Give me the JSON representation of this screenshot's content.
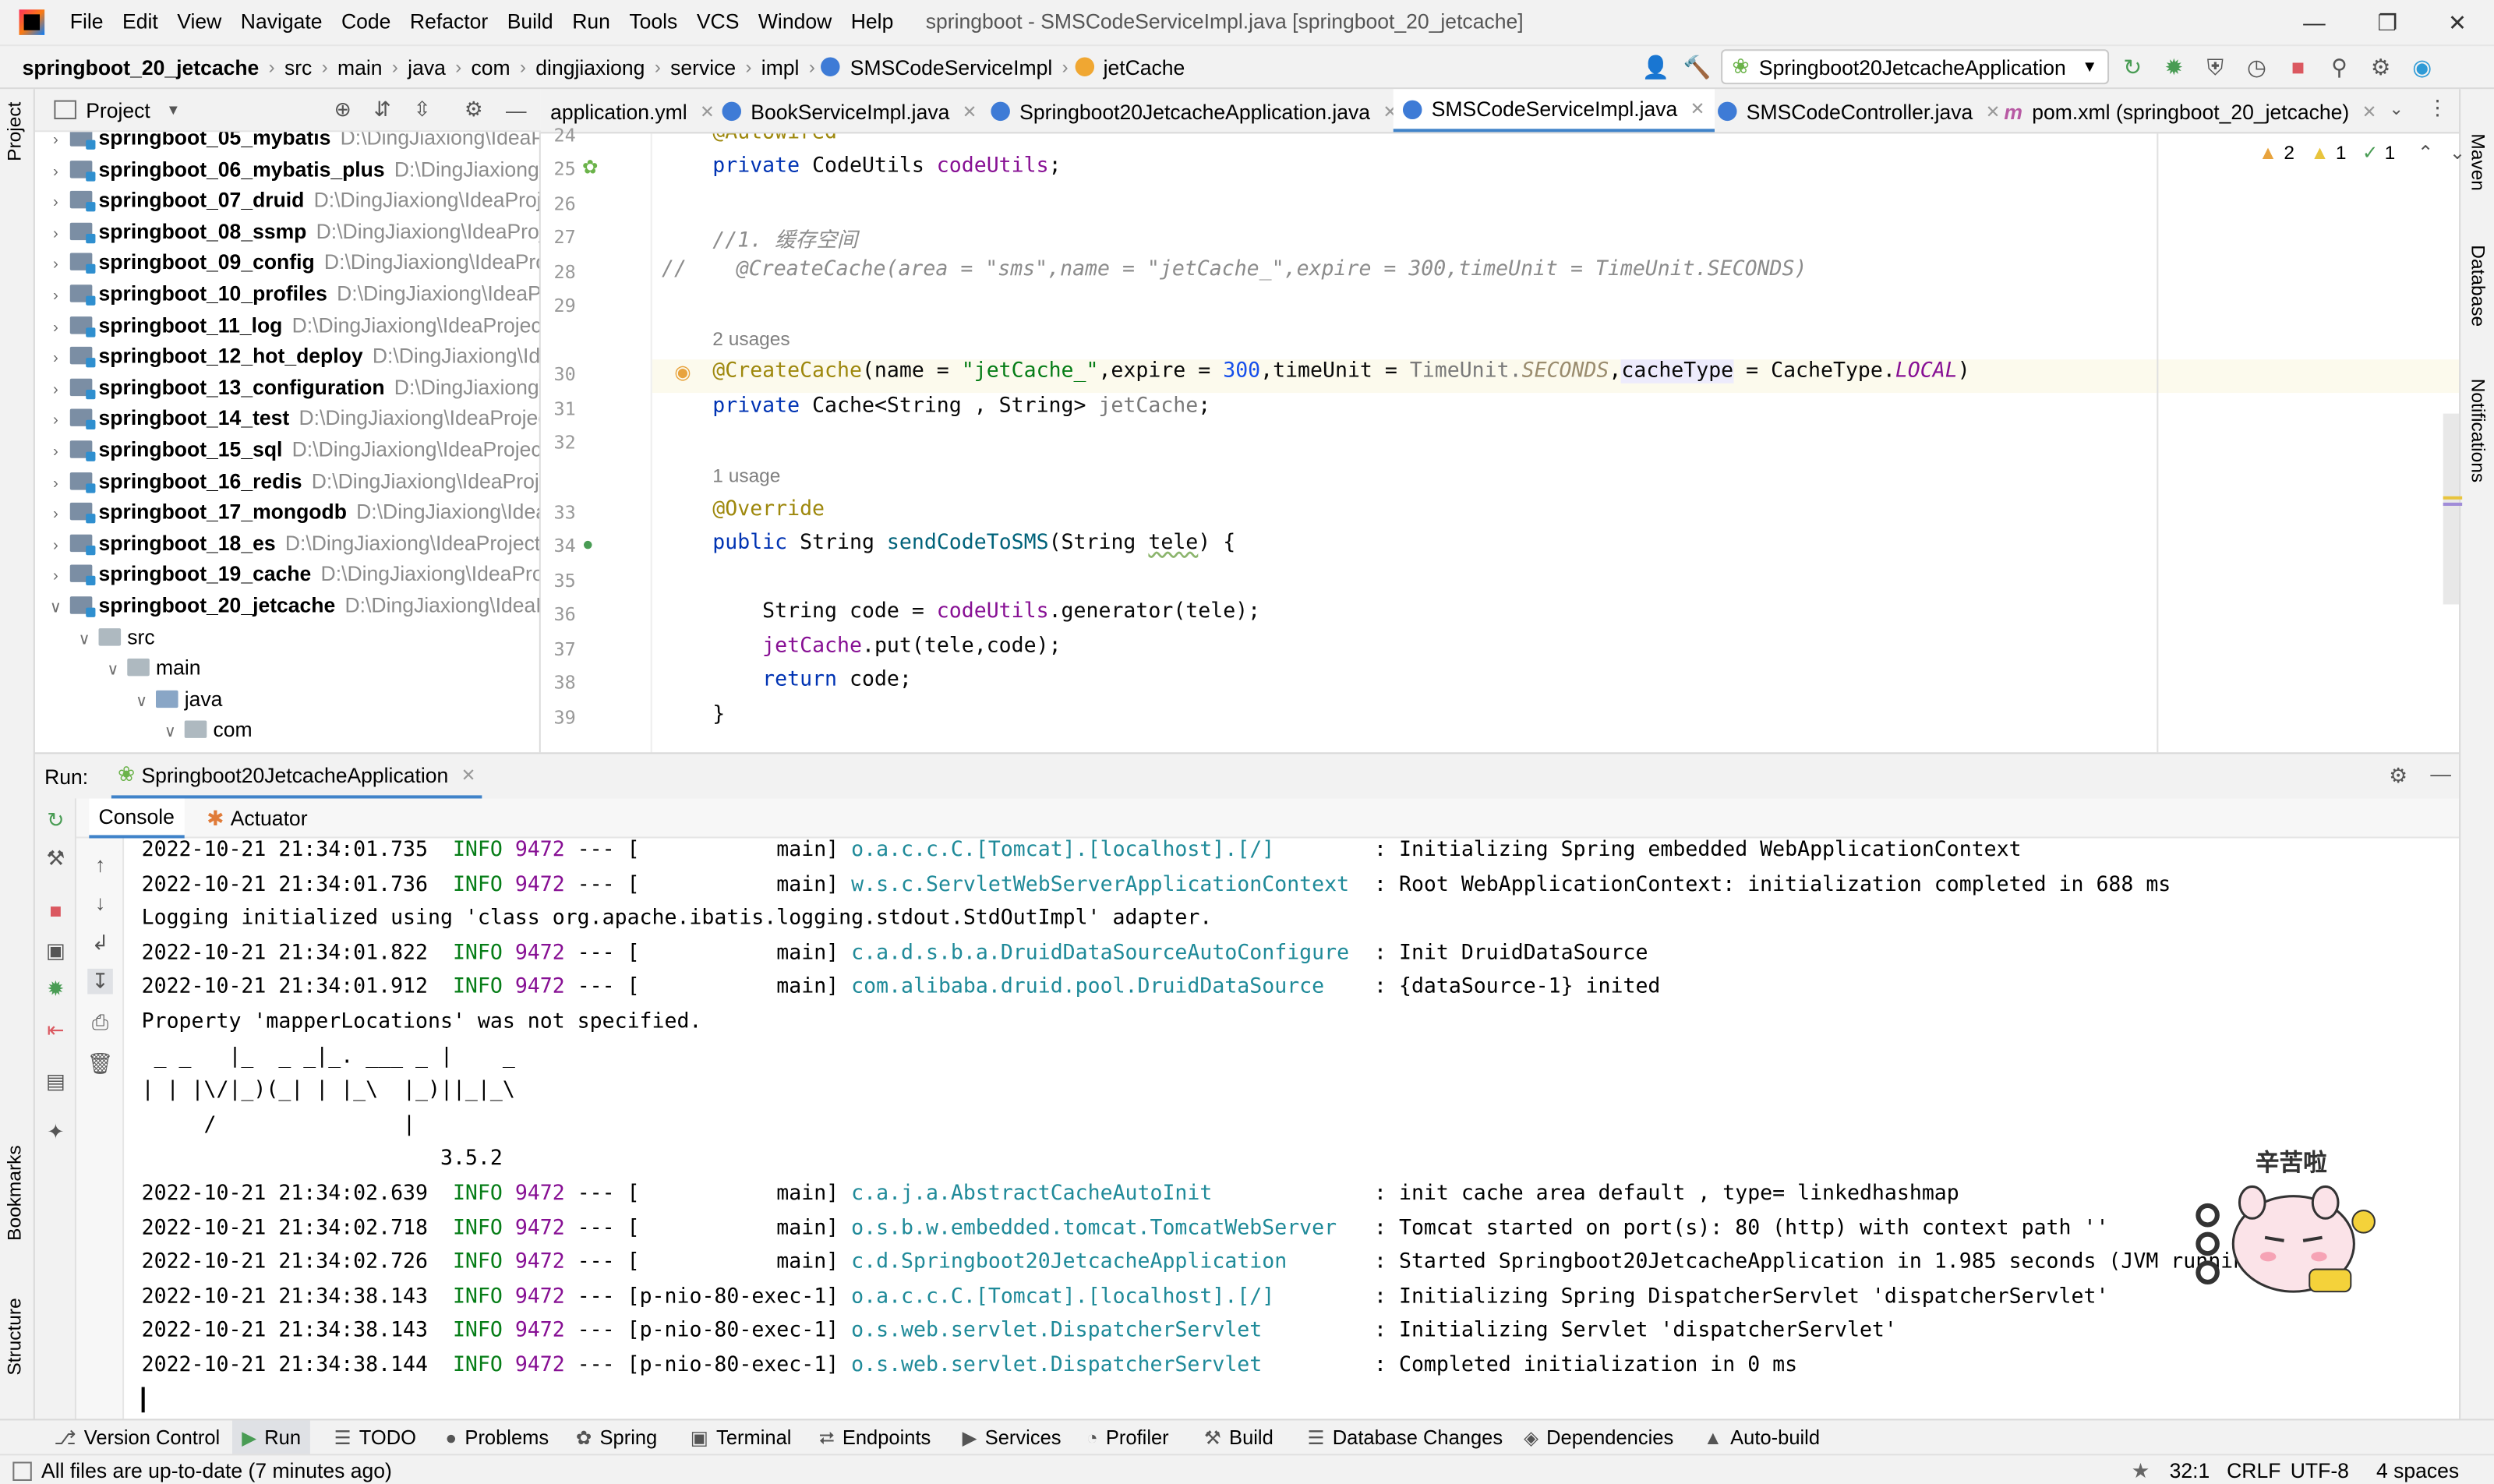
{
  "menu": {
    "items": [
      "File",
      "Edit",
      "View",
      "Navigate",
      "Code",
      "Refactor",
      "Build",
      "Run",
      "Tools",
      "VCS",
      "Window",
      "Help"
    ],
    "window_title": "springboot - SMSCodeServiceImpl.java [springboot_20_jetcache]"
  },
  "breadcrumb": {
    "items": [
      "springboot_20_jetcache",
      "src",
      "main",
      "java",
      "com",
      "dingjiaxiong",
      "service",
      "impl",
      "SMSCodeServiceImpl",
      "jetCache"
    ]
  },
  "toolbar": {
    "run_config": "Springboot20JetcacheApplication"
  },
  "project": {
    "title": "Project",
    "modules": [
      {
        "name": "springboot_05_mybatis",
        "path": "D:\\DingJiaxiong\\IdeaPr"
      },
      {
        "name": "springboot_06_mybatis_plus",
        "path": "D:\\DingJiaxiong\\Ic"
      },
      {
        "name": "springboot_07_druid",
        "path": "D:\\DingJiaxiong\\IdeaProje"
      },
      {
        "name": "springboot_08_ssmp",
        "path": "D:\\DingJiaxiong\\IdeaProje"
      },
      {
        "name": "springboot_09_config",
        "path": "D:\\DingJiaxiong\\IdeaProj"
      },
      {
        "name": "springboot_10_profiles",
        "path": "D:\\DingJiaxiong\\IdeaPro"
      },
      {
        "name": "springboot_11_log",
        "path": "D:\\DingJiaxiong\\IdeaProjects"
      },
      {
        "name": "springboot_12_hot_deploy",
        "path": "D:\\DingJiaxiong\\Ide"
      },
      {
        "name": "springboot_13_configuration",
        "path": "D:\\DingJiaxiong\\I"
      },
      {
        "name": "springboot_14_test",
        "path": "D:\\DingJiaxiong\\IdeaProject"
      },
      {
        "name": "springboot_15_sql",
        "path": "D:\\DingJiaxiong\\IdeaProjects"
      },
      {
        "name": "springboot_16_redis",
        "path": "D:\\DingJiaxiong\\IdeaProje"
      },
      {
        "name": "springboot_17_mongodb",
        "path": "D:\\DingJiaxiong\\Idea"
      },
      {
        "name": "springboot_18_es",
        "path": "D:\\DingJiaxiong\\IdeaProjects\\"
      },
      {
        "name": "springboot_19_cache",
        "path": "D:\\DingJiaxiong\\IdeaProje"
      },
      {
        "name": "springboot_20_jetcache",
        "path": "D:\\DingJiaxiong\\IdeaPr"
      }
    ],
    "sub": [
      "src",
      "main",
      "java",
      "com"
    ]
  },
  "tabs": [
    "application.yml",
    "BookServiceImpl.java",
    "Springboot20JetcacheApplication.java",
    "SMSCodeServiceImpl.java",
    "SMSCodeController.java",
    "pom.xml (springboot_20_jetcache)"
  ],
  "inspection": {
    "warnings": "2",
    "weak": "1",
    "ok": "1"
  },
  "editor": {
    "line_numbers": [
      "24",
      "25",
      "26",
      "27",
      "28",
      "29",
      "30",
      "31",
      "32",
      "33",
      "34",
      "35",
      "36",
      "37",
      "38",
      "39"
    ],
    "usages": [
      "2 usages",
      "1 usage"
    ],
    "comment_cn": "//1. 缓存空间"
  },
  "run": {
    "label": "Run:",
    "config": "Springboot20JetcacheApplication",
    "tabs": [
      "Console",
      "Actuator"
    ]
  },
  "console": {
    "lines": [
      {
        "ts": "2022-10-21 21:34:01.735",
        "lvl": "INFO",
        "pid": "9472",
        "thr": "--- [           main]",
        "logger": "o.a.c.c.C.[Tomcat].[localhost].[/]      ",
        "msg": " : Initializing Spring embedded WebApplicationContext"
      },
      {
        "ts": "2022-10-21 21:34:01.736",
        "lvl": "INFO",
        "pid": "9472",
        "thr": "--- [           main]",
        "logger": "w.s.c.ServletWebServerApplicationContext",
        "msg": " : Root WebApplicationContext: initialization completed in 688 ms"
      },
      {
        "plain": "Logging initialized using 'class org.apache.ibatis.logging.stdout.StdOutImpl' adapter."
      },
      {
        "ts": "2022-10-21 21:34:01.822",
        "lvl": "INFO",
        "pid": "9472",
        "thr": "--- [           main]",
        "logger": "c.a.d.s.b.a.DruidDataSourceAutoConfigure",
        "msg": " : Init DruidDataSource"
      },
      {
        "ts": "2022-10-21 21:34:01.912",
        "lvl": "INFO",
        "pid": "9472",
        "thr": "--- [           main]",
        "logger": "com.alibaba.druid.pool.DruidDataSource  ",
        "msg": " : {dataSource-1} inited"
      },
      {
        "plain": "Property 'mapperLocations' was not specified."
      },
      {
        "plain": " _ _   |_  _ _|_. ___ _ |    _ "
      },
      {
        "plain": "| | |\\/|_)(_| | |_\\  |_)||_|_\\ "
      },
      {
        "plain": "     /               |         "
      },
      {
        "plain": "                        3.5.2 "
      },
      {
        "ts": "2022-10-21 21:34:02.639",
        "lvl": "INFO",
        "pid": "9472",
        "thr": "--- [           main]",
        "logger": "c.a.j.a.AbstractCacheAutoInit           ",
        "msg": " : init cache area default , type= linkedhashmap"
      },
      {
        "ts": "2022-10-21 21:34:02.718",
        "lvl": "INFO",
        "pid": "9472",
        "thr": "--- [           main]",
        "logger": "o.s.b.w.embedded.tomcat.TomcatWebServer ",
        "msg": " : Tomcat started on port(s): 80 (http) with context path ''"
      },
      {
        "ts": "2022-10-21 21:34:02.726",
        "lvl": "INFO",
        "pid": "9472",
        "thr": "--- [           main]",
        "logger": "c.d.Springboot20JetcacheApplication     ",
        "msg": " : Started Springboot20JetcacheApplication in 1.985 seconds (JVM running"
      },
      {
        "ts": "2022-10-21 21:34:38.143",
        "lvl": "INFO",
        "pid": "9472",
        "thr": "--- [p-nio-80-exec-1]",
        "logger": "o.a.c.c.C.[Tomcat].[localhost].[/]      ",
        "msg": " : Initializing Spring DispatcherServlet 'dispatcherServlet'"
      },
      {
        "ts": "2022-10-21 21:34:38.143",
        "lvl": "INFO",
        "pid": "9472",
        "thr": "--- [p-nio-80-exec-1]",
        "logger": "o.s.web.servlet.DispatcherServlet       ",
        "msg": " : Initializing Servlet 'dispatcherServlet'"
      },
      {
        "ts": "2022-10-21 21:34:38.144",
        "lvl": "INFO",
        "pid": "9472",
        "thr": "--- [p-nio-80-exec-1]",
        "logger": "o.s.web.servlet.DispatcherServlet       ",
        "msg": " : Completed initialization in 0 ms"
      }
    ]
  },
  "sticker": {
    "text": "辛苦啦"
  },
  "tool_windows": [
    "Version Control",
    "Run",
    "TODO",
    "Problems",
    "Spring",
    "Terminal",
    "Endpoints",
    "Services",
    "Profiler",
    "Build",
    "Database Changes",
    "Dependencies",
    "Auto-build"
  ],
  "side": {
    "left": [
      "Project",
      "Bookmarks",
      "Structure"
    ],
    "right": [
      "Maven",
      "Database",
      "Notifications"
    ]
  },
  "status": {
    "message": "All files are up-to-date (7 minutes ago)",
    "position": "32:1",
    "line_sep": "CRLF",
    "encoding": "UTF-8",
    "indent": "4 spaces"
  },
  "colors": {
    "accent": "#4083c9",
    "keyword": "#0033b3",
    "string": "#067d17",
    "field": "#871094",
    "annotation": "#9e880d"
  }
}
